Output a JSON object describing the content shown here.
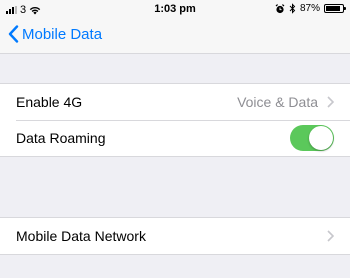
{
  "status_bar": {
    "carrier": "3",
    "time": "1:03 pm",
    "battery_percent": "87%",
    "battery_level": 0.87
  },
  "nav": {
    "back_label": "Mobile Data"
  },
  "settings": {
    "enable_4g": {
      "label": "Enable 4G",
      "value": "Voice & Data"
    },
    "data_roaming": {
      "label": "Data Roaming",
      "on": true
    },
    "mobile_data_network": {
      "label": "Mobile Data Network"
    }
  },
  "colors": {
    "accent": "#007aff",
    "toggle_on": "#5bc85b",
    "background": "#efeff4"
  }
}
